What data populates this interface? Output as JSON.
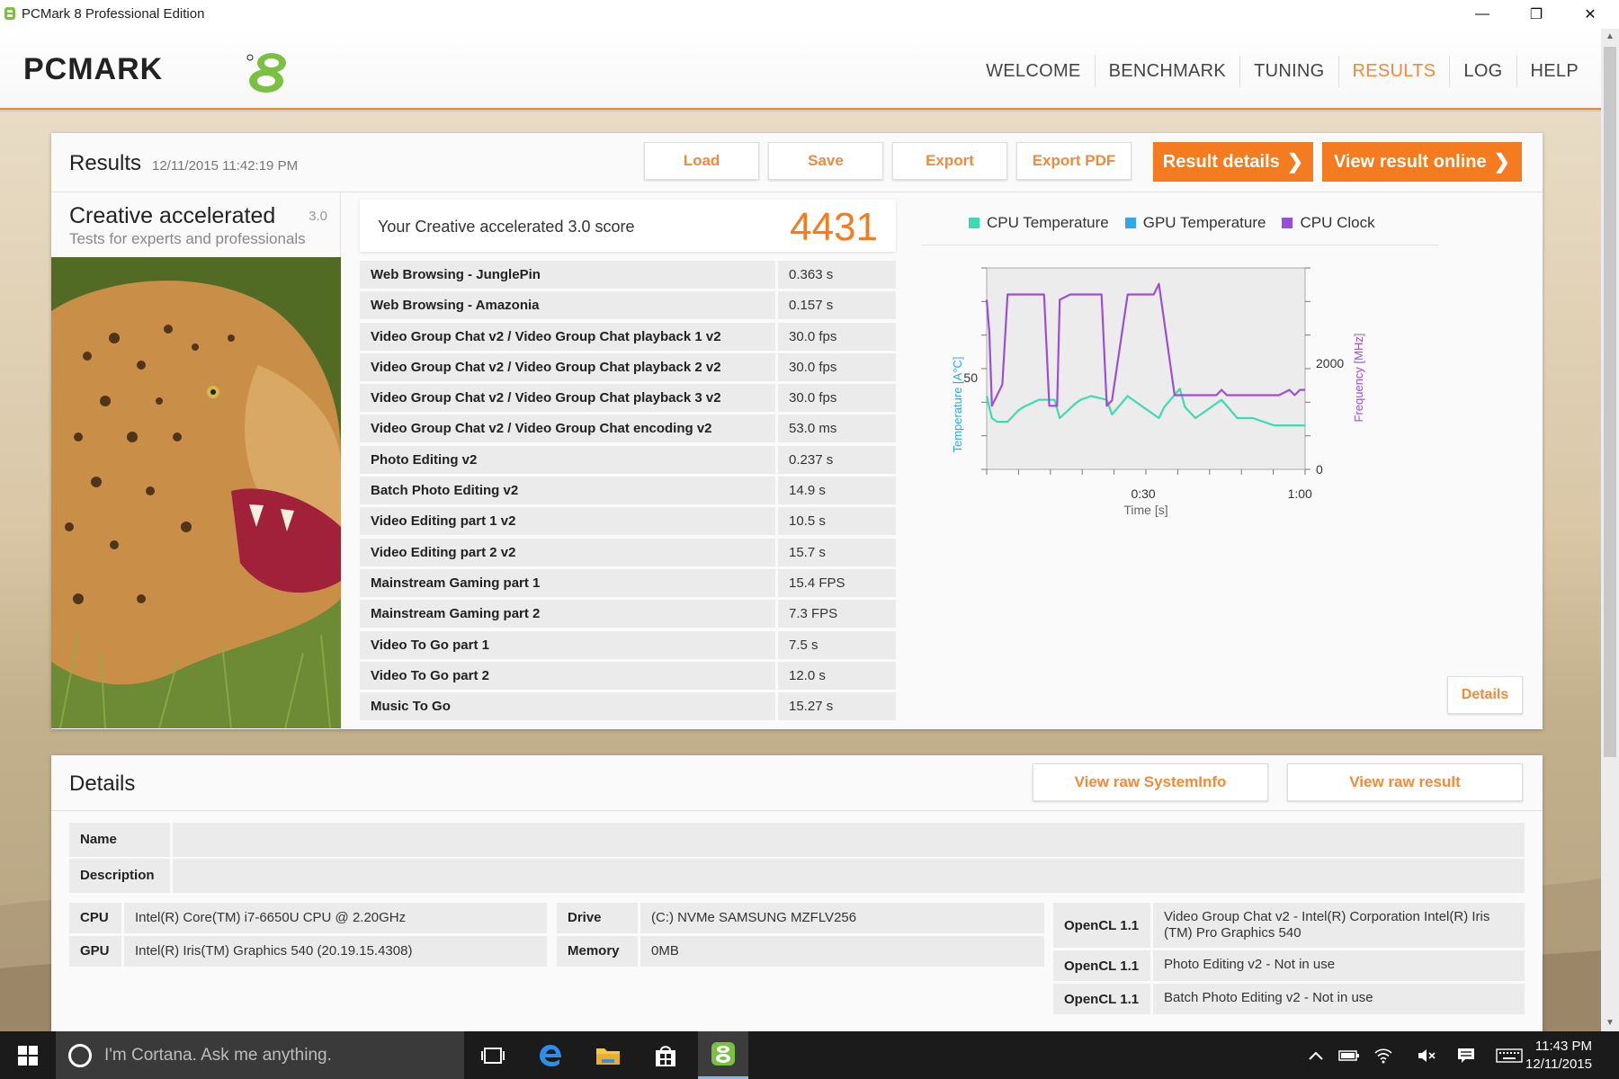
{
  "window": {
    "title": "PCMark 8 Professional Edition",
    "minimize": "—",
    "restore": "❐",
    "close": "✕"
  },
  "nav": [
    "WELCOME",
    "BENCHMARK",
    "TUNING",
    "RESULTS",
    "LOG",
    "HELP"
  ],
  "nav_active": "RESULTS",
  "colors": {
    "accent": "#f47b20",
    "cpu_temp": "#3ddbb4",
    "gpu_temp": "#30a8e8",
    "cpu_clock": "#9b4fd6"
  },
  "results": {
    "title": "Results",
    "date": "12/11/2015 11:42:19 PM",
    "buttons": {
      "load": "Load",
      "save": "Save",
      "export": "Export",
      "export_pdf": "Export PDF",
      "result_details": "Result details",
      "view_online": "View result online"
    },
    "test_name": "Creative accelerated",
    "test_version": "3.0",
    "test_desc": "Tests for experts and professionals",
    "score_label": "Your Creative accelerated 3.0 score",
    "score": "4431",
    "rows": [
      {
        "name": "Web Browsing - JunglePin",
        "value": "0.363 s"
      },
      {
        "name": "Web Browsing - Amazonia",
        "value": "0.157 s"
      },
      {
        "name": "Video Group Chat v2 / Video Group Chat playback 1 v2",
        "value": "30.0 fps"
      },
      {
        "name": "Video Group Chat v2 / Video Group Chat playback 2 v2",
        "value": "30.0 fps"
      },
      {
        "name": "Video Group Chat v2 / Video Group Chat playback 3 v2",
        "value": "30.0 fps"
      },
      {
        "name": "Video Group Chat v2 / Video Group Chat encoding v2",
        "value": "53.0 ms"
      },
      {
        "name": "Photo Editing v2",
        "value": "0.237 s"
      },
      {
        "name": "Batch Photo Editing v2",
        "value": "14.9 s"
      },
      {
        "name": "Video Editing part 1 v2",
        "value": "10.5 s"
      },
      {
        "name": "Video Editing part 2 v2",
        "value": "15.7 s"
      },
      {
        "name": "Mainstream Gaming part 1",
        "value": "15.4 FPS"
      },
      {
        "name": "Mainstream Gaming part 2",
        "value": "7.3 FPS"
      },
      {
        "name": "Video To Go part 1",
        "value": "7.5 s"
      },
      {
        "name": "Video To Go part 2",
        "value": "12.0 s"
      },
      {
        "name": "Music To Go",
        "value": "15.27 s"
      }
    ],
    "details_button": "Details"
  },
  "chart_data": {
    "type": "line",
    "legend": [
      "CPU Temperature",
      "GPU Temperature",
      "CPU Clock"
    ],
    "xlabel": "Time [s]",
    "ylabel_left": "Temperature [A°C]",
    "ylabel_right": "Frequency [MHz]",
    "x_ticks": [
      "0:30",
      "1:00"
    ],
    "y_left_ticks": [
      "50"
    ],
    "y_right_ticks": [
      "2000",
      "0"
    ],
    "x_range": [
      0,
      61
    ],
    "y_left_range": [
      25,
      80
    ],
    "y_right_range": [
      0,
      3800
    ],
    "series": [
      {
        "name": "CPU Temperature",
        "axis": "left",
        "x": [
          0,
          1,
          2,
          4,
          6,
          7,
          10,
          13,
          14,
          17,
          18,
          20,
          23,
          24,
          27,
          28,
          30,
          33,
          34,
          37,
          38,
          40,
          45,
          48,
          51,
          55,
          61
        ],
        "y": [
          45,
          39,
          38,
          38,
          41,
          42,
          44,
          44,
          39,
          43,
          44,
          45,
          44,
          40,
          45,
          44,
          42,
          39,
          42,
          47,
          42,
          39,
          44,
          39,
          39,
          37,
          37
        ]
      },
      {
        "name": "CPU Clock",
        "axis": "right",
        "x": [
          0,
          0.5,
          1,
          3,
          4,
          6,
          11,
          12,
          13.5,
          14,
          16,
          22,
          23,
          24,
          27,
          32,
          33,
          36,
          40,
          44,
          45,
          46,
          55,
          56,
          58,
          59,
          60,
          61
        ],
        "y": [
          3200,
          2600,
          1200,
          1600,
          3300,
          3300,
          3300,
          1200,
          1200,
          3200,
          3300,
          3300,
          1200,
          1300,
          3300,
          3300,
          3500,
          1400,
          1400,
          1400,
          1500,
          1400,
          1400,
          1400,
          1500,
          1400,
          1500,
          1500
        ]
      }
    ]
  },
  "details": {
    "title": "Details",
    "view_sysinfo": "View raw SystemInfo",
    "view_raw_result": "View raw result",
    "name_label": "Name",
    "description_label": "Description",
    "cpu_label": "CPU",
    "cpu_value": "Intel(R) Core(TM) i7-6650U CPU @ 2.20GHz",
    "gpu_label": "GPU",
    "gpu_value": "Intel(R) Iris(TM) Graphics 540 (20.19.15.4308)",
    "drive_label": "Drive",
    "drive_value": "(C:) NVMe SAMSUNG MZFLV256",
    "memory_label": "Memory",
    "memory_value": "0MB",
    "opencl": [
      {
        "label": "OpenCL 1.1",
        "value": "Video Group Chat v2 - Intel(R) Corporation Intel(R) Iris (TM) Pro Graphics 540"
      },
      {
        "label": "OpenCL 1.1",
        "value": "Photo Editing v2 - Not in use"
      },
      {
        "label": "OpenCL 1.1",
        "value": "Batch Photo Editing v2 - Not in use"
      }
    ]
  },
  "taskbar": {
    "cortana_text": "I'm Cortana. Ask me anything.",
    "time": "11:43 PM",
    "date": "12/11/2015"
  }
}
